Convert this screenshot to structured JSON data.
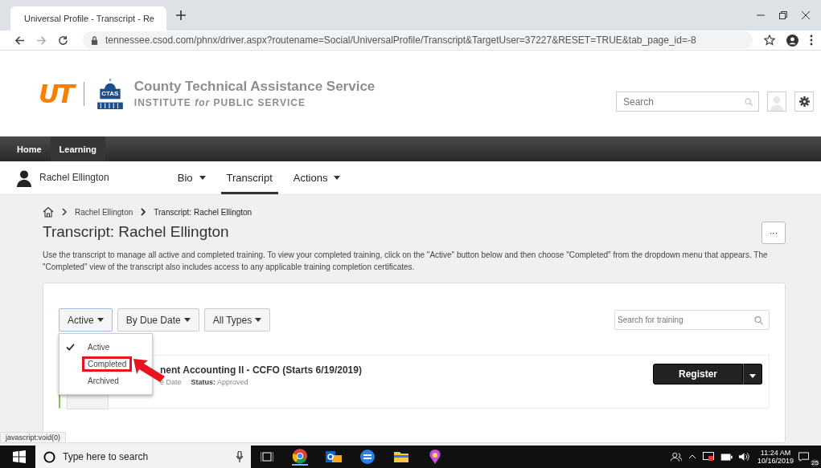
{
  "browser": {
    "tab_title": "Universal Profile - Transcript - Re",
    "url": "tennessee.csod.com/phnx/driver.aspx?routename=Social/UniversalProfile/Transcript&TargetUser=37227&RESET=TRUE&tab_page_id=-8"
  },
  "header": {
    "logo_text": "UT",
    "badge_text": "CTAS",
    "org_name": "County Technical Assistance Service",
    "org_sub": "INSTITUTE *for* PUBLIC SERVICE",
    "search_placeholder": "Search"
  },
  "nav": [
    {
      "label": "Home",
      "selected": false
    },
    {
      "label": "Learning",
      "selected": true
    }
  ],
  "profile": {
    "name": "Rachel Ellington",
    "tabs": [
      {
        "label": "Bio",
        "selected": false,
        "dropdown": true
      },
      {
        "label": "Transcript",
        "selected": true,
        "dropdown": false
      },
      {
        "label": "Actions",
        "selected": false,
        "dropdown": true
      }
    ]
  },
  "breadcrumb": [
    "Rachel Ellington",
    "Transcript: Rachel Ellington"
  ],
  "title": "Transcript: Rachel Ellington",
  "more_button": "···",
  "description": "Use the transcript to manage all active and completed training. To view your completed training, click on the \"Active\" button below and then choose \"Completed\" from the dropdown menu that appears. The \"Completed\" view of the transcript also includes access to any applicable training completion certificates.",
  "filters": [
    {
      "label": "Active",
      "selected": true
    },
    {
      "label": "By Due Date",
      "selected": false
    },
    {
      "label": "All Types",
      "selected": false
    }
  ],
  "status_menu": [
    {
      "label": "Active",
      "checked": true,
      "highlighted": false
    },
    {
      "label": "Completed",
      "checked": false,
      "highlighted": true
    },
    {
      "label": "Archived",
      "checked": false,
      "highlighted": false
    }
  ],
  "training_search": {
    "placeholder": "Search for training"
  },
  "course": {
    "title": "nent Accounting II - CCFO (Starts 6/19/2019)",
    "due": "e Date",
    "status_label": "Status:",
    "status": "Approved",
    "action": "Register"
  },
  "status_url": "javascript:void(0)",
  "taskbar": {
    "search_placeholder": "Type here to search",
    "time": "11:24 AM",
    "date": "10/16/2019",
    "notifications": "25"
  }
}
